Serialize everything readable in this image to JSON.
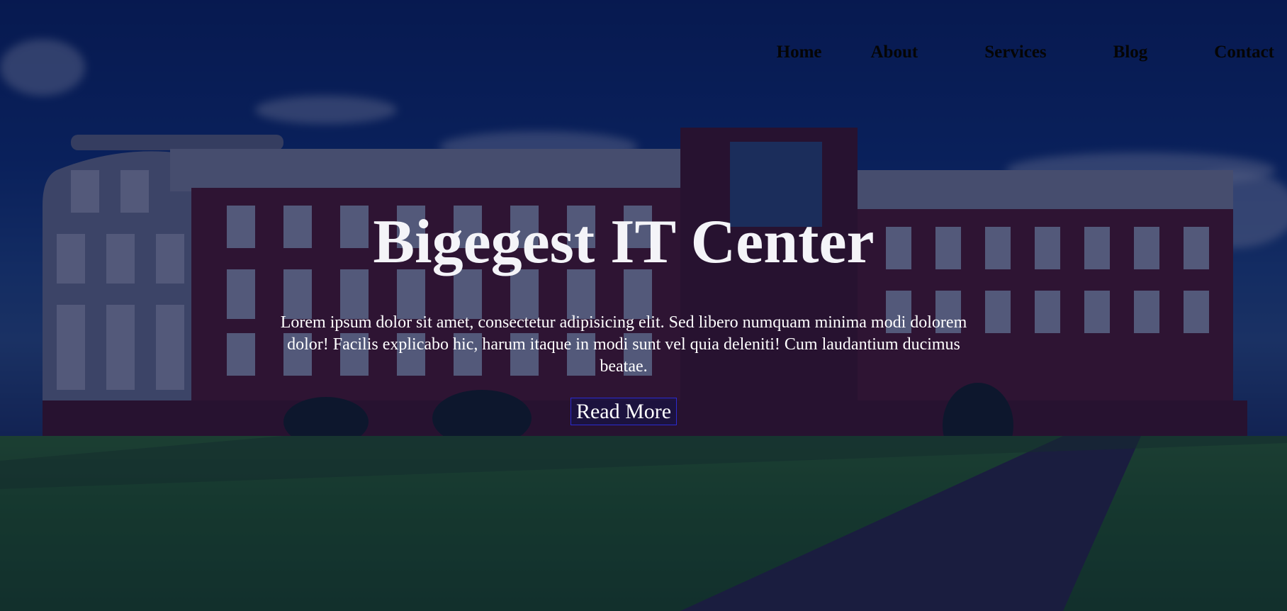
{
  "nav": {
    "items": [
      {
        "label": "Home"
      },
      {
        "label": "About"
      },
      {
        "label": "Services"
      },
      {
        "label": "Blog"
      },
      {
        "label": "Contact"
      }
    ]
  },
  "hero": {
    "title": "Bigegest IT Center",
    "description": "Lorem ipsum dolor sit amet, consectetur adipisicing elit. Sed libero numquam minima modi dolorem dolor! Facilis explicabo hic, harum itaque in modi sunt vel quia deleniti! Cum laudantium ducimus beatae.",
    "button_label": "Read More"
  },
  "colors": {
    "overlay": "#050c3c",
    "nav_text": "#050505",
    "hero_text": "#ffffff",
    "button_border": "#2b2bd0"
  }
}
